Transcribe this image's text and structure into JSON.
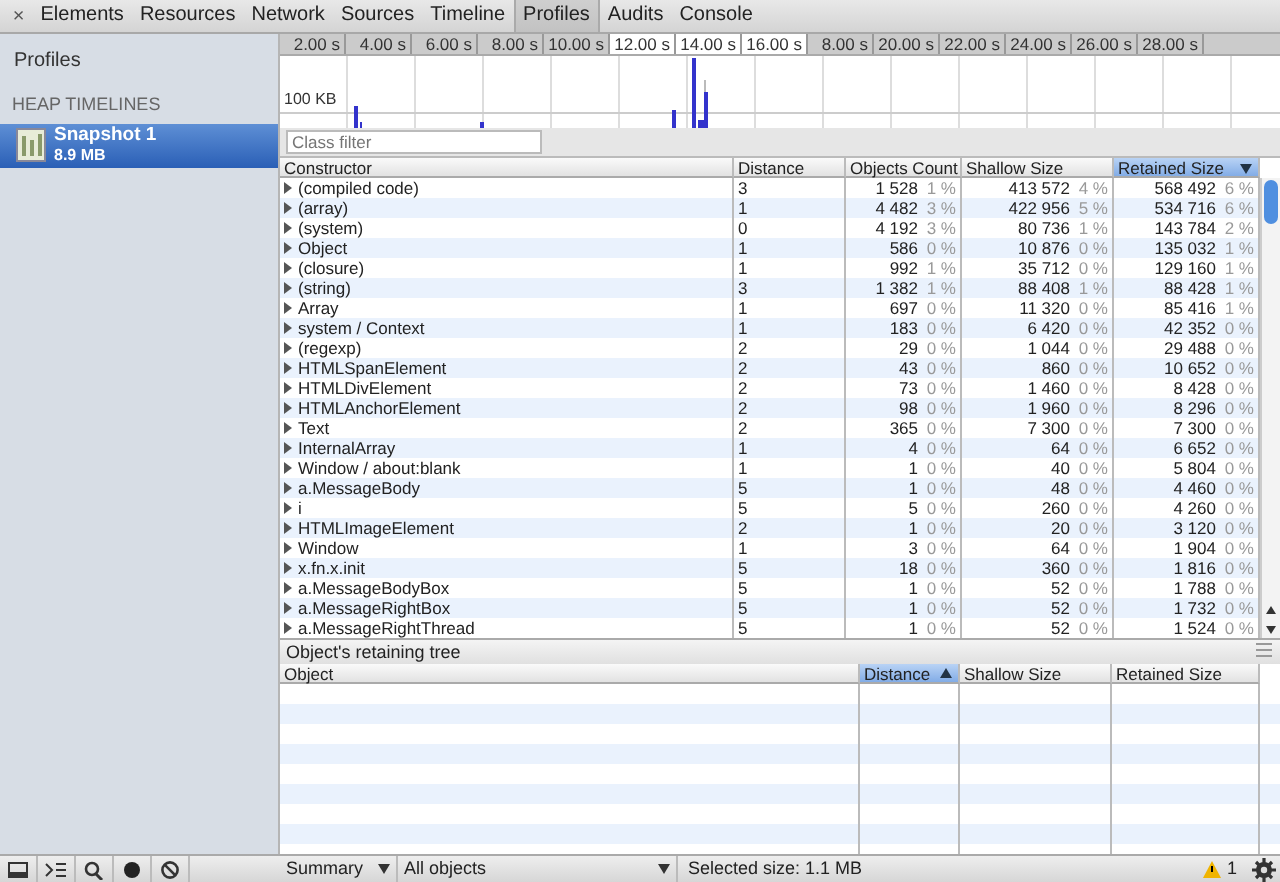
{
  "toolbar": {
    "close": "×",
    "tabs": [
      {
        "label": "Elements",
        "selected": false
      },
      {
        "label": "Resources",
        "selected": false
      },
      {
        "label": "Network",
        "selected": false
      },
      {
        "label": "Sources",
        "selected": false
      },
      {
        "label": "Timeline",
        "selected": false
      },
      {
        "label": "Profiles",
        "selected": true
      },
      {
        "label": "Audits",
        "selected": false
      },
      {
        "label": "Console",
        "selected": false
      }
    ]
  },
  "sidebar": {
    "title": "Profiles",
    "section": "HEAP TIMELINES",
    "items": [
      {
        "name": "Snapshot 1",
        "size": "8.9 MB",
        "selected": true
      }
    ]
  },
  "timeline": {
    "ticks": [
      {
        "label": "2.00 s",
        "selected": false
      },
      {
        "label": "4.00 s",
        "selected": false
      },
      {
        "label": "6.00 s",
        "selected": false
      },
      {
        "label": "8.00 s",
        "selected": false
      },
      {
        "label": "10.00 s",
        "selected": false
      },
      {
        "label": "12.00 s",
        "selected": true
      },
      {
        "label": "14.00 s",
        "selected": true
      },
      {
        "label": "16.00 s",
        "selected": true
      },
      {
        "label": "8.00 s",
        "selected": false
      },
      {
        "label": "20.00 s",
        "selected": false
      },
      {
        "label": "22.00 s",
        "selected": false
      },
      {
        "label": "24.00 s",
        "selected": false
      },
      {
        "label": "26.00 s",
        "selected": false
      },
      {
        "label": "28.00 s",
        "selected": false
      }
    ],
    "axis_label": "100 KB"
  },
  "class_filter": {
    "placeholder": "Class filter"
  },
  "table": {
    "columns": [
      {
        "label": "Constructor",
        "sorted": false
      },
      {
        "label": "Distance",
        "sorted": false
      },
      {
        "label": "Objects Count",
        "sorted": false
      },
      {
        "label": "Shallow Size",
        "sorted": false
      },
      {
        "label": "Retained Size",
        "sorted": true,
        "descending": true
      }
    ],
    "rows": [
      {
        "name": "(compiled code)",
        "distance": "3",
        "objects_count": {
          "value": "1 528",
          "percent": "1 %"
        },
        "shallow_size": {
          "value": "413 572",
          "percent": "4 %"
        },
        "retained_size": {
          "value": "568 492",
          "percent": "6 %"
        }
      },
      {
        "name": "(array)",
        "distance": "1",
        "objects_count": {
          "value": "4 482",
          "percent": "3 %"
        },
        "shallow_size": {
          "value": "422 956",
          "percent": "5 %"
        },
        "retained_size": {
          "value": "534 716",
          "percent": "6 %"
        }
      },
      {
        "name": "(system)",
        "distance": "0",
        "objects_count": {
          "value": "4 192",
          "percent": "3 %"
        },
        "shallow_size": {
          "value": "80 736",
          "percent": "1 %"
        },
        "retained_size": {
          "value": "143 784",
          "percent": "2 %"
        }
      },
      {
        "name": "Object",
        "distance": "1",
        "objects_count": {
          "value": "586",
          "percent": "0 %"
        },
        "shallow_size": {
          "value": "10 876",
          "percent": "0 %"
        },
        "retained_size": {
          "value": "135 032",
          "percent": "1 %"
        }
      },
      {
        "name": "(closure)",
        "distance": "1",
        "objects_count": {
          "value": "992",
          "percent": "1 %"
        },
        "shallow_size": {
          "value": "35 712",
          "percent": "0 %"
        },
        "retained_size": {
          "value": "129 160",
          "percent": "1 %"
        }
      },
      {
        "name": "(string)",
        "distance": "3",
        "objects_count": {
          "value": "1 382",
          "percent": "1 %"
        },
        "shallow_size": {
          "value": "88 408",
          "percent": "1 %"
        },
        "retained_size": {
          "value": "88 428",
          "percent": "1 %"
        }
      },
      {
        "name": "Array",
        "distance": "1",
        "objects_count": {
          "value": "697",
          "percent": "0 %"
        },
        "shallow_size": {
          "value": "11 320",
          "percent": "0 %"
        },
        "retained_size": {
          "value": "85 416",
          "percent": "1 %"
        }
      },
      {
        "name": "system / Context",
        "distance": "1",
        "objects_count": {
          "value": "183",
          "percent": "0 %"
        },
        "shallow_size": {
          "value": "6 420",
          "percent": "0 %"
        },
        "retained_size": {
          "value": "42 352",
          "percent": "0 %"
        }
      },
      {
        "name": "(regexp)",
        "distance": "2",
        "objects_count": {
          "value": "29",
          "percent": "0 %"
        },
        "shallow_size": {
          "value": "1 044",
          "percent": "0 %"
        },
        "retained_size": {
          "value": "29 488",
          "percent": "0 %"
        }
      },
      {
        "name": "HTMLSpanElement",
        "distance": "2",
        "objects_count": {
          "value": "43",
          "percent": "0 %"
        },
        "shallow_size": {
          "value": "860",
          "percent": "0 %"
        },
        "retained_size": {
          "value": "10 652",
          "percent": "0 %"
        }
      },
      {
        "name": "HTMLDivElement",
        "distance": "2",
        "objects_count": {
          "value": "73",
          "percent": "0 %"
        },
        "shallow_size": {
          "value": "1 460",
          "percent": "0 %"
        },
        "retained_size": {
          "value": "8 428",
          "percent": "0 %"
        }
      },
      {
        "name": "HTMLAnchorElement",
        "distance": "2",
        "objects_count": {
          "value": "98",
          "percent": "0 %"
        },
        "shallow_size": {
          "value": "1 960",
          "percent": "0 %"
        },
        "retained_size": {
          "value": "8 296",
          "percent": "0 %"
        }
      },
      {
        "name": "Text",
        "distance": "2",
        "objects_count": {
          "value": "365",
          "percent": "0 %"
        },
        "shallow_size": {
          "value": "7 300",
          "percent": "0 %"
        },
        "retained_size": {
          "value": "7 300",
          "percent": "0 %"
        }
      },
      {
        "name": "InternalArray",
        "distance": "1",
        "objects_count": {
          "value": "4",
          "percent": "0 %"
        },
        "shallow_size": {
          "value": "64",
          "percent": "0 %"
        },
        "retained_size": {
          "value": "6 652",
          "percent": "0 %"
        }
      },
      {
        "name": "Window / about:blank",
        "distance": "1",
        "objects_count": {
          "value": "1",
          "percent": "0 %"
        },
        "shallow_size": {
          "value": "40",
          "percent": "0 %"
        },
        "retained_size": {
          "value": "5 804",
          "percent": "0 %"
        }
      },
      {
        "name": "a.MessageBody",
        "distance": "5",
        "objects_count": {
          "value": "1",
          "percent": "0 %"
        },
        "shallow_size": {
          "value": "48",
          "percent": "0 %"
        },
        "retained_size": {
          "value": "4 460",
          "percent": "0 %"
        }
      },
      {
        "name": "i",
        "distance": "5",
        "objects_count": {
          "value": "5",
          "percent": "0 %"
        },
        "shallow_size": {
          "value": "260",
          "percent": "0 %"
        },
        "retained_size": {
          "value": "4 260",
          "percent": "0 %"
        }
      },
      {
        "name": "HTMLImageElement",
        "distance": "2",
        "objects_count": {
          "value": "1",
          "percent": "0 %"
        },
        "shallow_size": {
          "value": "20",
          "percent": "0 %"
        },
        "retained_size": {
          "value": "3 120",
          "percent": "0 %"
        }
      },
      {
        "name": "Window",
        "distance": "1",
        "objects_count": {
          "value": "3",
          "percent": "0 %"
        },
        "shallow_size": {
          "value": "64",
          "percent": "0 %"
        },
        "retained_size": {
          "value": "1 904",
          "percent": "0 %"
        }
      },
      {
        "name": "x.fn.x.init",
        "distance": "5",
        "objects_count": {
          "value": "18",
          "percent": "0 %"
        },
        "shallow_size": {
          "value": "360",
          "percent": "0 %"
        },
        "retained_size": {
          "value": "1 816",
          "percent": "0 %"
        }
      },
      {
        "name": "a.MessageBodyBox",
        "distance": "5",
        "objects_count": {
          "value": "1",
          "percent": "0 %"
        },
        "shallow_size": {
          "value": "52",
          "percent": "0 %"
        },
        "retained_size": {
          "value": "1 788",
          "percent": "0 %"
        }
      },
      {
        "name": "a.MessageRightBox",
        "distance": "5",
        "objects_count": {
          "value": "1",
          "percent": "0 %"
        },
        "shallow_size": {
          "value": "52",
          "percent": "0 %"
        },
        "retained_size": {
          "value": "1 732",
          "percent": "0 %"
        }
      },
      {
        "name": "a.MessageRightThread",
        "distance": "5",
        "objects_count": {
          "value": "1",
          "percent": "0 %"
        },
        "shallow_size": {
          "value": "52",
          "percent": "0 %"
        },
        "retained_size": {
          "value": "1 524",
          "percent": "0 %"
        }
      }
    ]
  },
  "retaining_tree": {
    "title": "Object's retaining tree",
    "columns": [
      {
        "label": "Object",
        "sorted": false
      },
      {
        "label": "Distance",
        "sorted": true,
        "descending": false
      },
      {
        "label": "Shallow Size",
        "sorted": false
      },
      {
        "label": "Retained Size",
        "sorted": false
      }
    ]
  },
  "status_bar": {
    "view": "Summary",
    "filter": "All objects",
    "selected_size": "Selected size: 1.1 MB",
    "warnings": "1"
  }
}
